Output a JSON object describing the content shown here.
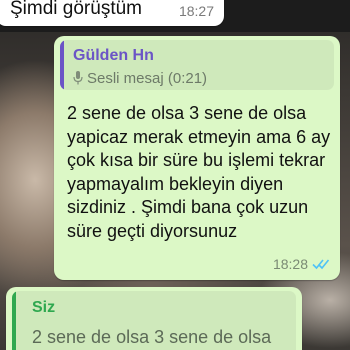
{
  "chat": {
    "top_message": {
      "text": "Şimdi görüştüm",
      "time": "18:27"
    },
    "reply_message": {
      "quoted_author": "Gülden Hn",
      "quoted_preview": "Sesli mesaj (0:21)",
      "body": "2 sene de olsa 3 sene de olsa yapicaz merak etmeyin ama 6 ay çok kısa bir süre bu işlemi tekrar yapmayalım bekleyin diyen sizdiniz . Şimdi bana çok uzun süre geçti diyorsunuz",
      "time": "18:28",
      "status_icon": "double-check-read-icon"
    },
    "bottom_message": {
      "quoted_author": "Siz",
      "quoted_text": "2 sene de olsa 3 sene de olsa"
    }
  },
  "colors": {
    "outgoing_bubble": "#dcf8c6",
    "quote_author_purple": "#6b54c6",
    "quote_author_green": "#2fa84f",
    "read_ticks": "#4fc3f7"
  }
}
